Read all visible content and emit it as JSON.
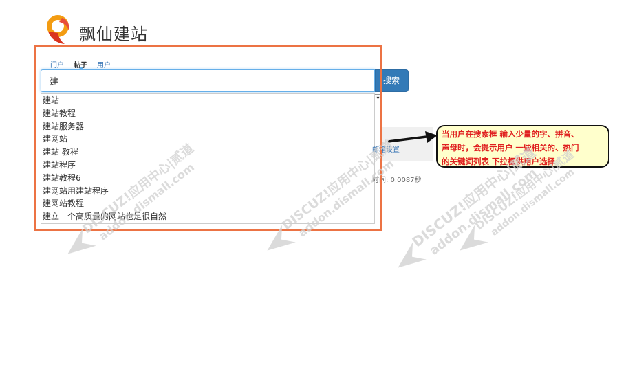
{
  "brand": {
    "title": "飘仙建站"
  },
  "search": {
    "tabs": [
      {
        "label": "门户",
        "active": false
      },
      {
        "label": "帖子",
        "active": true
      },
      {
        "label": "用户",
        "active": false
      }
    ],
    "query": "建",
    "button_label": "搜索",
    "suggestions": [
      "建站",
      "建站教程",
      "建站服务器",
      "建网站",
      "建站 教程",
      "建站程序",
      "建站教程6",
      "建网站用建站程序",
      "建网站教程",
      "建立一个高质量的网站也是很自然"
    ]
  },
  "background": {
    "link_fragment": "邮箱设置",
    "time_fragment": "时间: 0.0087秒"
  },
  "annotation": {
    "line1": "当用户在搜索框 输入少量的字、拼音、",
    "line2": "声母时，会提示用户 一些相关的、热门",
    "line3": "的关键词列表 下拉框供用户选择"
  },
  "watermark": {
    "brand": "DISCUZ!应用中心|贰道",
    "domain": "addon.dismall.com"
  },
  "colors": {
    "highlight": "#ec7344",
    "primary_button": "#337ab7",
    "callout_fill": "#ffffcc",
    "callout_text": "#e02020"
  }
}
